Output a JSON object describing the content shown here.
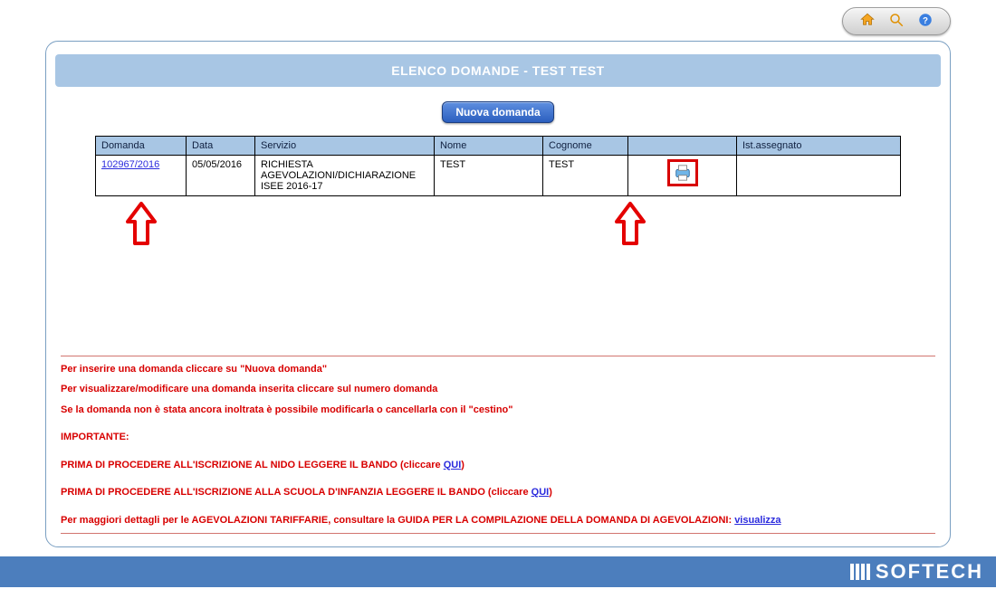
{
  "toolbar": {
    "home_icon": "home-icon",
    "search_icon": "search-icon",
    "help_icon": "help-icon"
  },
  "header": {
    "title": "ELENCO DOMANDE - TEST TEST"
  },
  "actions": {
    "new_request": "Nuova domanda"
  },
  "grid": {
    "columns": [
      "Domanda",
      "Data",
      "Servizio",
      "Nome",
      "Cognome",
      "",
      "Ist.assegnato"
    ],
    "rows": [
      {
        "domanda": "102967/2016",
        "data": "05/05/2016",
        "servizio": "RICHIESTA AGEVOLAZIONI/DICHIARAZIONE ISEE 2016-17",
        "nome": "TEST",
        "cognome": "TEST",
        "ist": ""
      }
    ]
  },
  "instructions": {
    "line1": "Per inserire una domanda cliccare su \"Nuova domanda\"",
    "line2": "Per visualizzare/modificare una domanda inserita cliccare sul numero domanda",
    "line3": "Se la domanda non è stata ancora inoltrata è possibile modificarla o cancellarla con il \"cestino\"",
    "important": "IMPORTANTE:",
    "nido_pre": "PRIMA DI PROCEDERE ALL'ISCRIZIONE AL NIDO LEGGERE IL BANDO (cliccare ",
    "qui1": "QUI",
    "nido_post": ")",
    "infanzia_pre": "PRIMA DI PROCEDERE ALL'ISCRIZIONE ALLA SCUOLA D'INFANZIA LEGGERE IL BANDO (cliccare ",
    "qui2": "QUI",
    "infanzia_post": ")",
    "agev_pre": "Per maggiori dettagli per le AGEVOLAZIONI TARIFFARIE, consultare la GUIDA PER LA COMPILAZIONE DELLA DOMANDA DI AGEVOLAZIONI: ",
    "visualizza": "visualizza"
  },
  "footer": {
    "brand": "SOFTECH"
  }
}
